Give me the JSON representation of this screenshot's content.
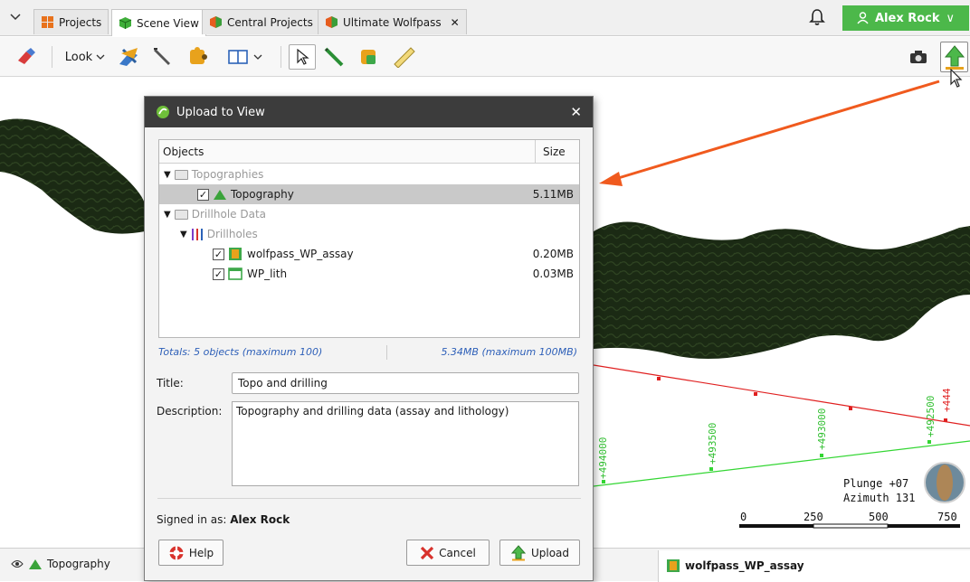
{
  "tabs": [
    {
      "label": "Projects",
      "icon": "grid-icon",
      "active": false
    },
    {
      "label": "Scene View",
      "icon": "cube-icon",
      "active": true
    },
    {
      "label": "Central Projects",
      "icon": "central-icon",
      "active": false
    },
    {
      "label": "Ultimate Wolfpass",
      "icon": "project-icon",
      "active": false,
      "close": "✕"
    }
  ],
  "user": {
    "name": "Alex Rock",
    "chevron": "∨"
  },
  "toolbar": {
    "look_label": "Look"
  },
  "scene": {
    "colors": {
      "terrain": "#1b2a14",
      "red_line": "#e02020",
      "green_line": "#33d633",
      "arrow": "#f05a1e"
    },
    "green_labels": [
      "+494000",
      "+493500",
      "+493000",
      "+492500"
    ],
    "red_label": "+444",
    "orientation": {
      "plunge": "Plunge +07",
      "azimuth": "Azimuth 131"
    },
    "scale": [
      "0",
      "250",
      "500",
      "750"
    ]
  },
  "bottom": {
    "left_item": "Topography",
    "right_item": "wolfpass_WP_assay"
  },
  "dialog": {
    "title": "Upload to View",
    "close": "✕",
    "col_objects": "Objects",
    "col_size": "Size",
    "rows": [
      {
        "name": "Topographies",
        "size": "",
        "kind": "folder"
      },
      {
        "name": "Topography",
        "size": "5.11MB",
        "kind": "item",
        "checked": true
      },
      {
        "name": "Drillhole Data",
        "size": "",
        "kind": "folder"
      },
      {
        "name": "Drillholes",
        "size": "",
        "kind": "folder"
      },
      {
        "name": "wolfpass_WP_assay",
        "size": "0.20MB",
        "kind": "item",
        "checked": true
      },
      {
        "name": "WP_lith",
        "size": "0.03MB",
        "kind": "item",
        "checked": true
      }
    ],
    "totals_left": "Totals: 5 objects (maximum 100)",
    "totals_right": "5.34MB (maximum 100MB)",
    "title_label": "Title:",
    "title_value": "Topo and drilling",
    "description_label": "Description:",
    "description_value": "Topography and drilling data (assay and lithology)",
    "signed_in_prefix": "Signed in as:",
    "signed_in_user": "Alex Rock",
    "help_label": "Help",
    "cancel_label": "Cancel",
    "upload_label": "Upload"
  }
}
